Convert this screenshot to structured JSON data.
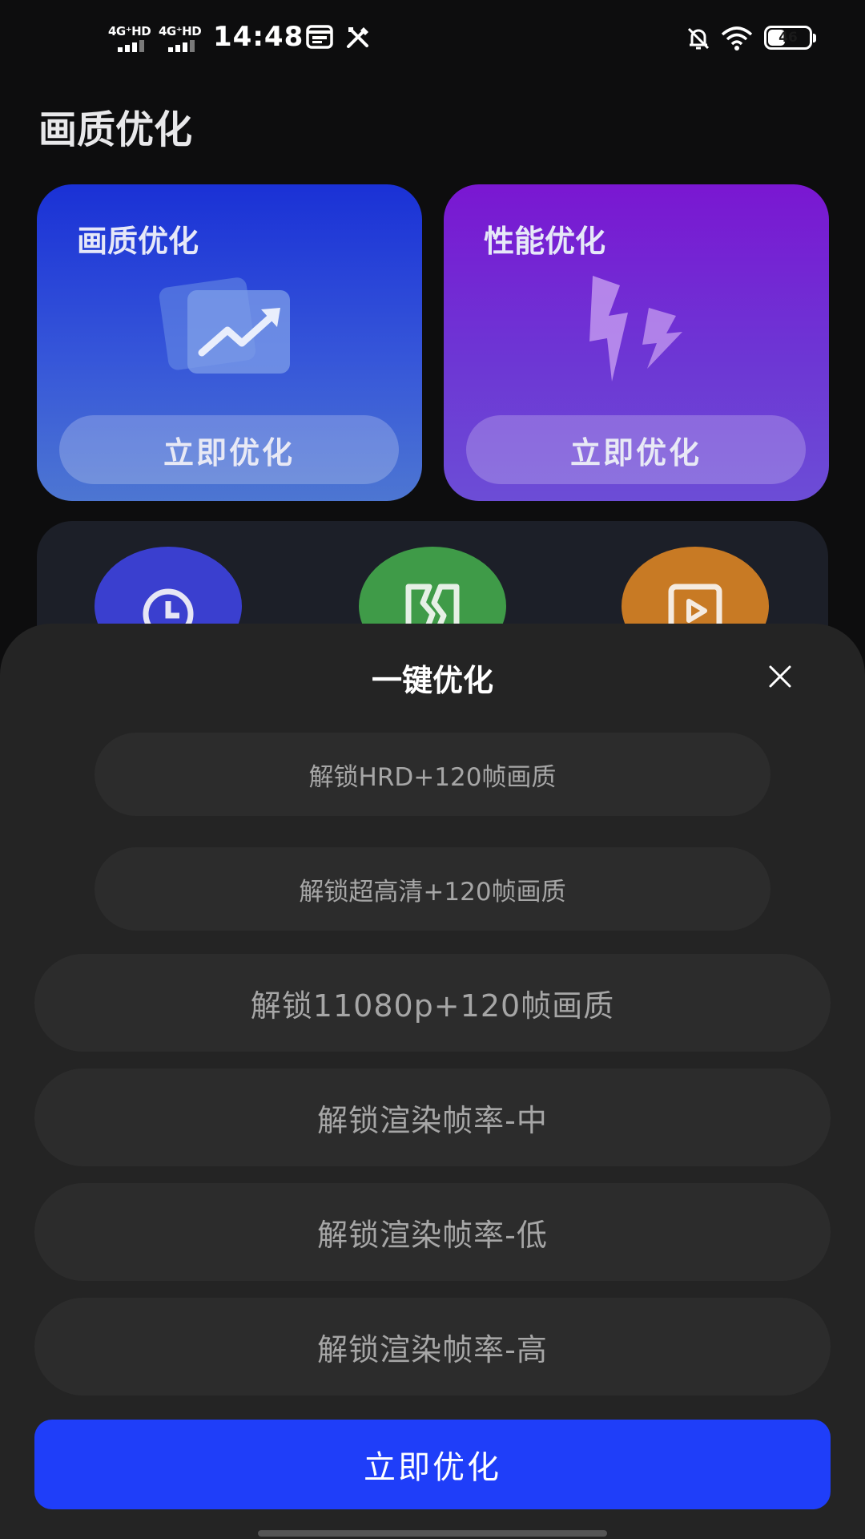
{
  "status_bar": {
    "sim1": "4G⁺HD",
    "sim2": "4G⁺HD",
    "time": "14:48",
    "battery": 46,
    "battery_text": "46"
  },
  "page": {
    "title": "画质优化"
  },
  "cards": [
    {
      "title": "画质优化",
      "button": "立即优化",
      "icon": "trend-chart-icon",
      "color": "#2a45d8"
    },
    {
      "title": "性能优化",
      "button": "立即优化",
      "icon": "lightning-icon",
      "color": "#7424d4"
    }
  ],
  "tools": [
    {
      "icon": "clock-icon",
      "color": "#3a3fcf"
    },
    {
      "icon": "broken-frame-icon",
      "color": "#3f9b48"
    },
    {
      "icon": "video-play-icon",
      "color": "#c87a24"
    }
  ],
  "sheet": {
    "title": "一键优化",
    "options": [
      "解锁HRD+120帧画质",
      "解锁超高清+120帧画质",
      "解锁11080p+120帧画质",
      "解锁渲染帧率-中",
      "解锁渲染帧率-低",
      "解锁渲染帧率-高"
    ],
    "confirm": "立即优化",
    "accent": "#1f3ef9"
  }
}
